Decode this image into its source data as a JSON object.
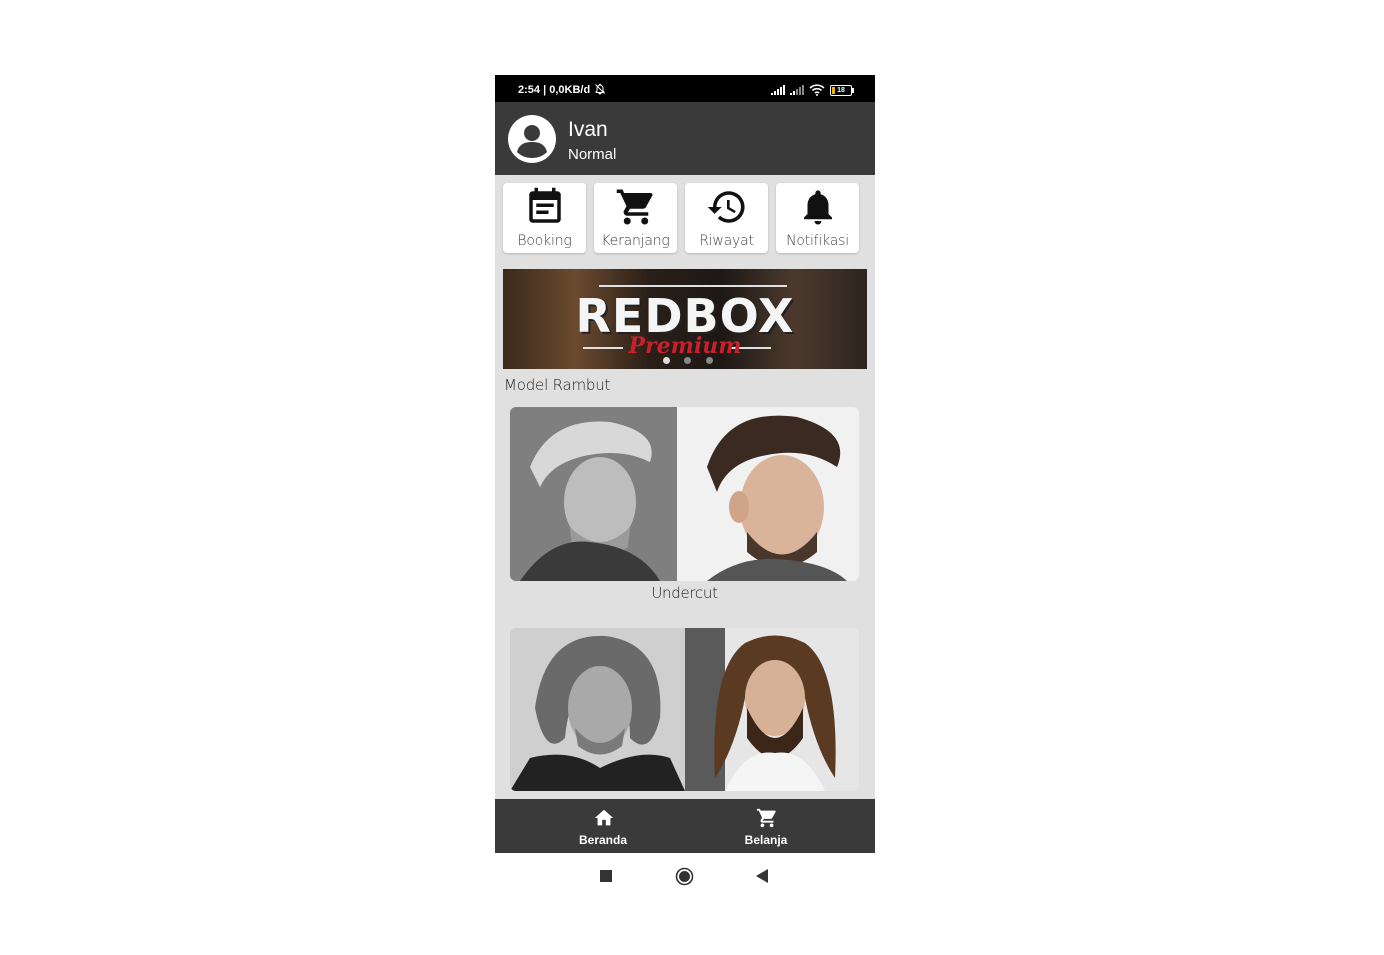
{
  "status_bar": {
    "time": "2:54 | 0,0KB/d",
    "battery": "18"
  },
  "header": {
    "user_name": "Ivan",
    "user_level": "Normal"
  },
  "menu": {
    "items": [
      {
        "label": "Booking",
        "icon": "calendar-icon"
      },
      {
        "label": "Keranjang",
        "icon": "cart-icon"
      },
      {
        "label": "Riwayat",
        "icon": "history-icon"
      },
      {
        "label": "Notifikasi",
        "icon": "bell-icon"
      }
    ]
  },
  "banner": {
    "title": "REDBOX",
    "subtitle": "Premium",
    "slide_count": 3,
    "active_slide": 0
  },
  "section": {
    "title": "Model Rambut"
  },
  "hair_models": [
    {
      "caption": "Undercut"
    },
    {
      "caption": ""
    }
  ],
  "bottom_nav": {
    "items": [
      {
        "label": "Beranda",
        "icon": "home-icon"
      },
      {
        "label": "Belanja",
        "icon": "cart-icon"
      }
    ]
  },
  "colors": {
    "header_bg": "#3a3a3a",
    "page_bg": "#e0e0e0",
    "brand_red": "#c9202b"
  }
}
